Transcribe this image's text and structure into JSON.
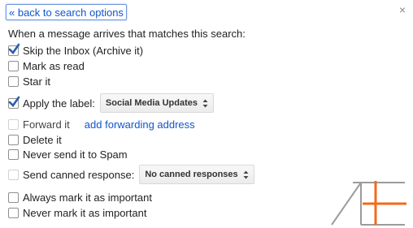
{
  "header": {
    "back_label": "« back to search options",
    "close_glyph": "×"
  },
  "intro": "When a message arrives that matches this search:",
  "options": {
    "skip_inbox": {
      "label": "Skip the Inbox (Archive it)",
      "checked": true
    },
    "mark_read": {
      "label": "Mark as read",
      "checked": false
    },
    "star": {
      "label": "Star it",
      "checked": false
    },
    "apply_label": {
      "label": "Apply the label:",
      "checked": true,
      "select_value": "Social Media Updates"
    },
    "forward": {
      "label": "Forward it",
      "checked": false,
      "disabled": true,
      "link": "add forwarding address"
    },
    "delete": {
      "label": "Delete it",
      "checked": false
    },
    "never_spam": {
      "label": "Never send it to Spam",
      "checked": false
    },
    "canned": {
      "label": "Send canned response:",
      "checked": false,
      "disabled": true,
      "select_value": "No canned responses"
    },
    "always_important": {
      "label": "Always mark it as important",
      "checked": false
    },
    "never_important": {
      "label": "Never mark it as important",
      "checked": false
    }
  },
  "icons": {
    "close": "close-icon",
    "checkmark": "checkmark-icon",
    "select_arrows": "updown-arrows-icon",
    "logo": "ae-logo"
  },
  "colors": {
    "link": "#1155cc",
    "checkmark": "#2a5db0",
    "logo_gray": "#9b9b9b",
    "logo_orange": "#f26a1b"
  }
}
